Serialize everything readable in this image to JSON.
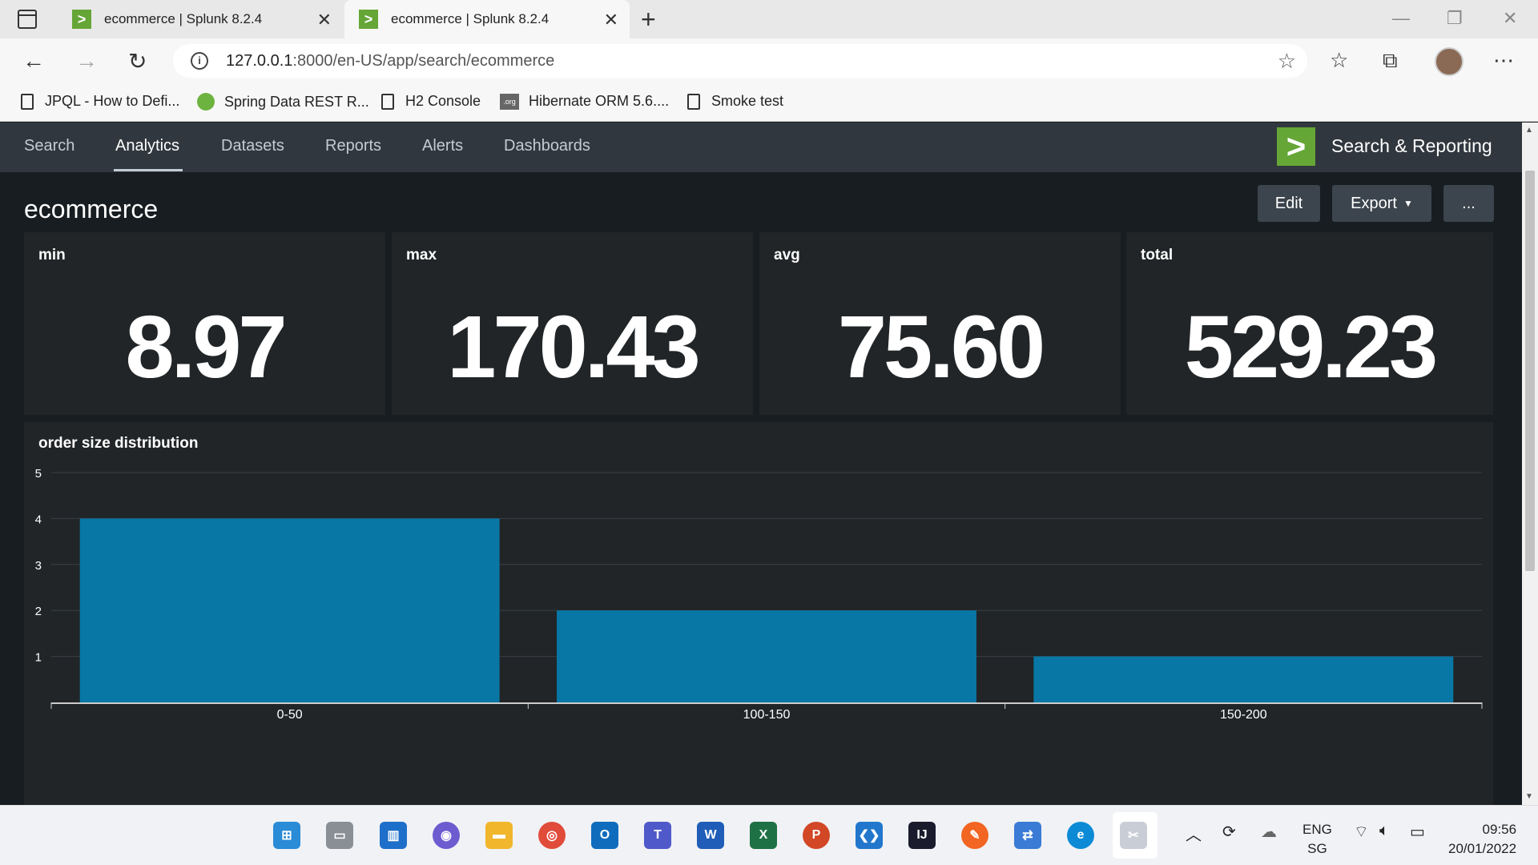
{
  "browser": {
    "tabs": [
      {
        "title": "ecommerce | Splunk 8.2.4",
        "active": false
      },
      {
        "title": "ecommerce | Splunk 8.2.4",
        "active": true
      }
    ],
    "url_host": "127.0.0.1",
    "url_path": ":8000/en-US/app/search/ecommerce",
    "bookmarks": [
      {
        "label": "JPQL - How to Defi...",
        "icon": "document-icon"
      },
      {
        "label": "Spring Data REST R...",
        "icon": "spring-icon"
      },
      {
        "label": "H2 Console",
        "icon": "document-icon"
      },
      {
        "label": "Hibernate ORM 5.6....",
        "icon": "hibernate-icon"
      },
      {
        "label": "Smoke test",
        "icon": "document-icon"
      }
    ]
  },
  "app": {
    "nav": [
      "Search",
      "Analytics",
      "Datasets",
      "Reports",
      "Alerts",
      "Dashboards"
    ],
    "active_nav": "Analytics",
    "logo_glyph": ">",
    "name": "Search & Reporting",
    "accent": "#65a637"
  },
  "dashboard": {
    "title": "ecommerce",
    "buttons": {
      "edit": "Edit",
      "export": "Export",
      "more": "..."
    },
    "stats": [
      {
        "label": "min",
        "value": "8.97"
      },
      {
        "label": "max",
        "value": "170.43"
      },
      {
        "label": "avg",
        "value": "75.60"
      },
      {
        "label": "total",
        "value": "529.23"
      }
    ]
  },
  "chart_data": {
    "type": "bar",
    "title": "order size distribution",
    "categories": [
      "0-50",
      "100-150",
      "150-200"
    ],
    "values": [
      4,
      2,
      1
    ],
    "ylim": [
      0,
      5
    ],
    "yticks": [
      1,
      2,
      3,
      4,
      5
    ],
    "bar_color": "#0877a6",
    "grid": true
  },
  "taskbar": {
    "language": "ENG",
    "region": "SG",
    "time": "09:56",
    "date": "20/01/2022"
  }
}
